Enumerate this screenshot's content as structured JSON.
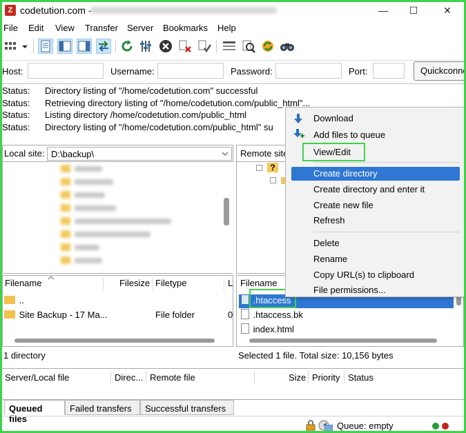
{
  "window": {
    "title": "codetution.com - ",
    "minimize_icon": "minimize-icon",
    "maximize_icon": "maximize-icon",
    "close_icon": "close-icon",
    "minimize_glyph": "—",
    "maximize_glyph": "☐",
    "close_glyph": "✕",
    "app_logo": "Z"
  },
  "menu": [
    "File",
    "Edit",
    "View",
    "Transfer",
    "Server",
    "Bookmarks",
    "Help"
  ],
  "quickconnect": {
    "host_label": "Host:",
    "username_label": "Username:",
    "password_label": "Password:",
    "port_label": "Port:",
    "host_value": "",
    "username_value": "",
    "password_value": "",
    "port_value": "",
    "button_label": "Quickconnect"
  },
  "log": [
    {
      "label": "Status:",
      "message": "Directory listing of \"/home/codetution.com\" successful"
    },
    {
      "label": "Status:",
      "message": "Retrieving directory listing of \"/home/codetution.com/public_html\"..."
    },
    {
      "label": "Status:",
      "message": "Listing directory /home/codetution.com/public_html"
    },
    {
      "label": "Status:",
      "message": "Directory listing of \"/home/codetution.com/public_html\" su"
    }
  ],
  "local": {
    "site_label": "Local site:",
    "path": "D:\\backup\\",
    "columns": [
      "Filename",
      "Filesize",
      "Filetype",
      "L"
    ],
    "rows": [
      {
        "name": "..",
        "size": "",
        "type": ""
      },
      {
        "name": "Site Backup - 17 Ma...",
        "size": "",
        "type": "File folder",
        "extra": "0"
      }
    ],
    "status": "1 directory"
  },
  "remote": {
    "site_label": "Remote site",
    "columns": [
      "Filename"
    ],
    "rows": [
      {
        "name": ".htaccess",
        "selected": true
      },
      {
        "name": ".htaccess.bk",
        "selected": false
      },
      {
        "name": "index.html",
        "selected": false
      }
    ],
    "status": "Selected 1 file. Total size: 10,156 bytes"
  },
  "context_menu": {
    "items": [
      {
        "label": "Download",
        "icon": "download-icon"
      },
      {
        "label": "Add files to queue",
        "icon": "add-queue-icon"
      },
      {
        "label": "View/Edit"
      },
      {
        "label": "Create directory",
        "highlighted": true
      },
      {
        "label": "Create directory and enter it"
      },
      {
        "label": "Create new file"
      },
      {
        "label": "Refresh"
      },
      {
        "label": "Delete"
      },
      {
        "label": "Rename"
      },
      {
        "label": "Copy URL(s) to clipboard"
      },
      {
        "label": "File permissions..."
      }
    ]
  },
  "queue": {
    "columns": [
      "Server/Local file",
      "Direc...",
      "Remote file",
      "Size",
      "Priority",
      "Status"
    ],
    "tabs": [
      "Queued files",
      "Failed transfers",
      "Successful transfers"
    ],
    "status": "Queue: empty"
  },
  "colors": {
    "accent_green": "#3fd34a",
    "selection_blue": "#2f77d2"
  }
}
